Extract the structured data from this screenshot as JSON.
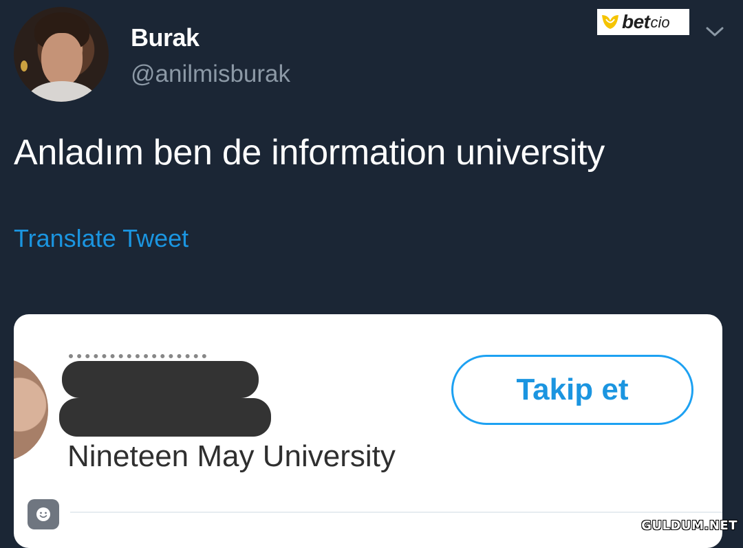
{
  "tweet": {
    "author_name": "Burak",
    "author_handle": "@anilmisburak",
    "text": "Anladım ben de information university",
    "translate_label": "Translate Tweet"
  },
  "embedded_profile": {
    "bio": "Nineteen May University",
    "follow_label": "Takip et"
  },
  "brand_logo": {
    "bet": "bet",
    "cio": "cio"
  },
  "watermark": "GULDUM.NET",
  "colors": {
    "background": "#1b2635",
    "accent": "#1b95e0",
    "card": "#ffffff",
    "redaction": "#333333"
  }
}
